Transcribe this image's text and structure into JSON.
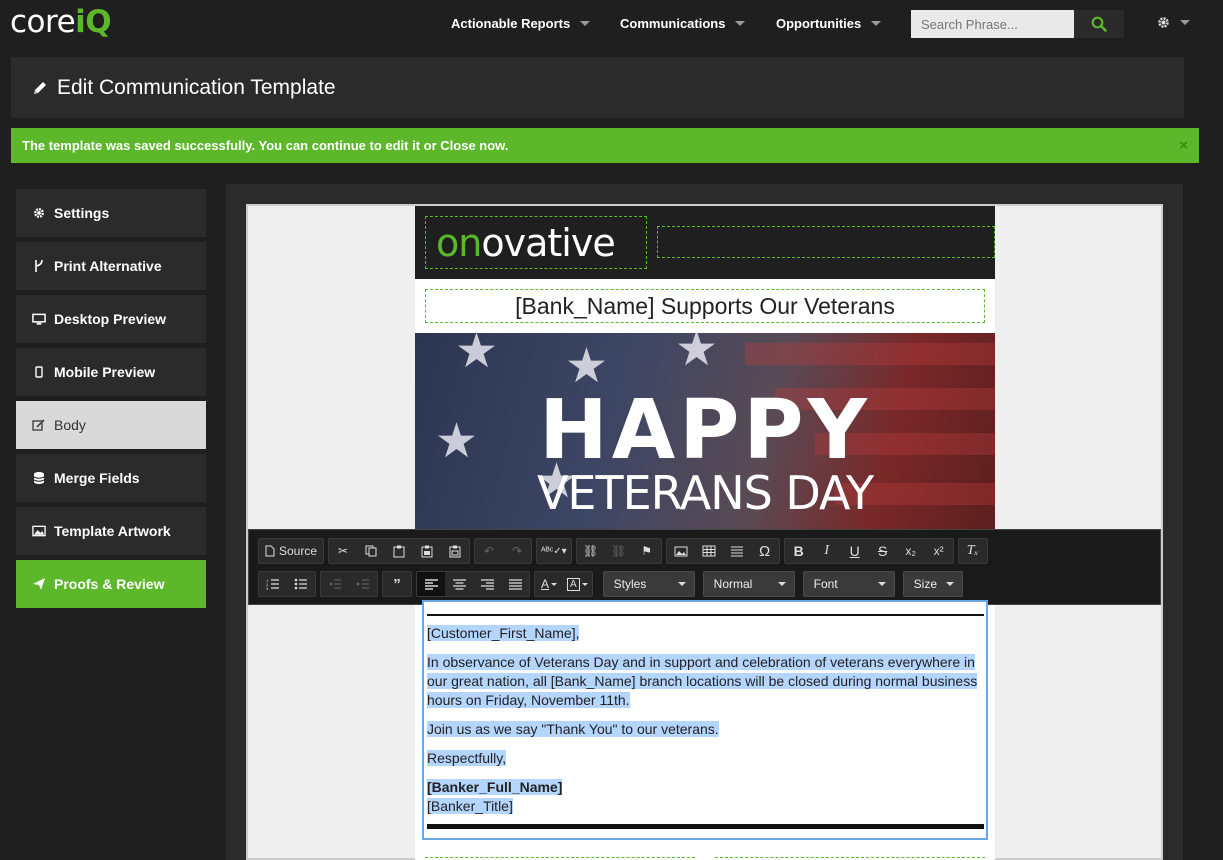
{
  "app": {
    "logo_core": "core",
    "logo_iq": "iQ"
  },
  "nav": {
    "items": [
      {
        "label": "Actionable Reports"
      },
      {
        "label": "Communications"
      },
      {
        "label": "Opportunities"
      }
    ],
    "search_placeholder": "Search Phrase..."
  },
  "header": {
    "title": "Edit Communication Template"
  },
  "alert": {
    "message": "The template was saved successfully. You can continue to edit it or Close now.",
    "close": "×"
  },
  "sidebar": {
    "items": [
      {
        "label": "Settings",
        "icon": "gear-icon"
      },
      {
        "label": "Print Alternative",
        "icon": "fork-icon"
      },
      {
        "label": "Desktop Preview",
        "icon": "desktop-icon"
      },
      {
        "label": "Mobile Preview",
        "icon": "mobile-icon"
      },
      {
        "label": "Body",
        "icon": "edit-icon",
        "state": "active"
      },
      {
        "label": "Merge Fields",
        "icon": "database-icon"
      },
      {
        "label": "Template Artwork",
        "icon": "image-icon"
      },
      {
        "label": "Proofs & Review",
        "icon": "send-icon",
        "state": "green"
      }
    ]
  },
  "email": {
    "brand_on": "on",
    "brand_rest": "ovative",
    "title": "[Bank_Name] Supports Our Veterans",
    "banner_line1": "HAPPY",
    "banner_line2": "VETERANS DAY",
    "greeting": "[Customer_First_Name],",
    "paragraph1": "In observance of Veterans Day and in support and celebration of veterans everywhere in our great nation, all [Bank_Name] branch locations will be closed during normal business hours on Friday, November 11th.",
    "paragraph2": "Join us as we say \"Thank You\" to our veterans.",
    "closing": "Respectfully,",
    "banker_name": "[Banker_Full_Name]",
    "banker_title": "[Banker_Title]"
  },
  "toolbar": {
    "source": "Source",
    "styles": "Styles",
    "format": "Normal",
    "font": "Font",
    "size": "Size"
  },
  "colors": {
    "accent": "#5cb82a",
    "background": "#1f1f1f",
    "panel": "#2b2b2b",
    "selection": "#b4d5fe"
  }
}
